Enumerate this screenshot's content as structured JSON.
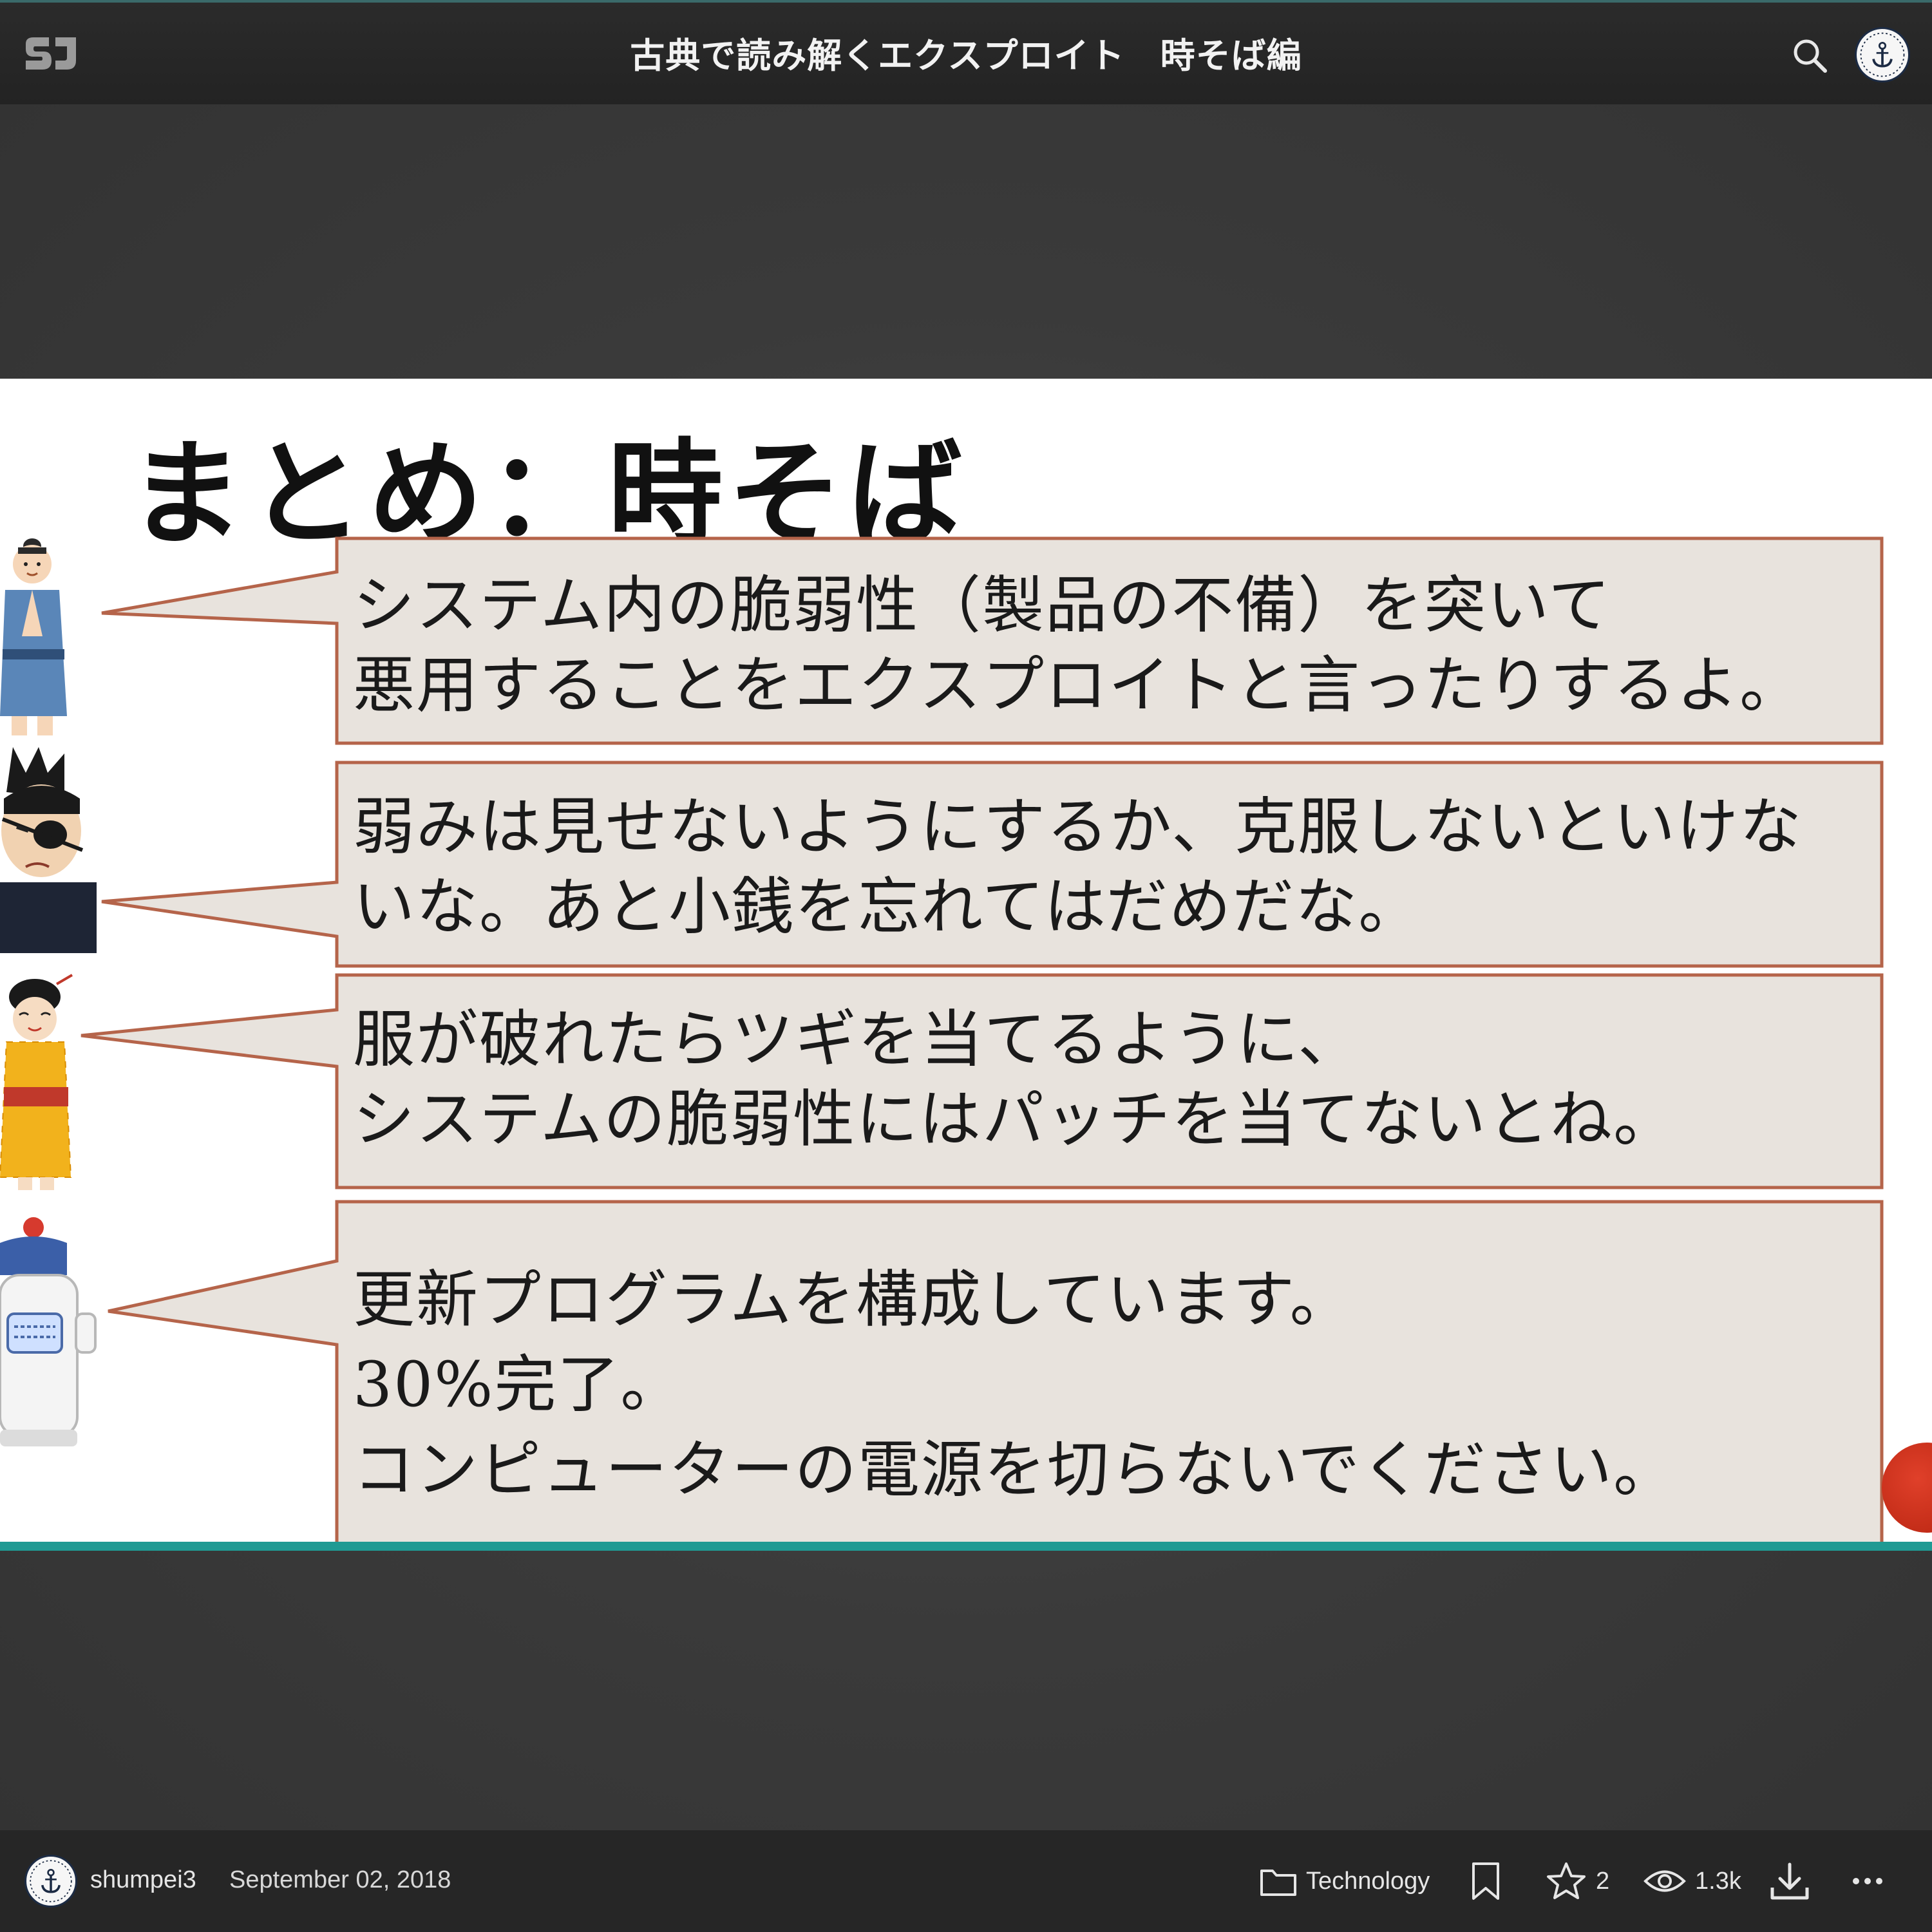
{
  "header": {
    "logo_text": "SJ",
    "title": "古典で読み解くエクスプロイト　時そば編"
  },
  "slide": {
    "heading": "まとめ：時そば",
    "bubbles": [
      {
        "speaker": "samurai-townsman",
        "lines": [
          "システム内の脆弱性（製品の不備）を突いて",
          "悪用することをエクスプロイトと言ったりするよ。"
        ]
      },
      {
        "speaker": "eyepatch-samurai",
        "lines": [
          "弱みは見せないようにするか、克服しないといけな",
          "いな。あと小銭を忘れてはだめだな。"
        ]
      },
      {
        "speaker": "edo-woman",
        "lines": [
          "服が破れたらツギを当てるように、",
          "システムの脆弱性にはパッチを当てないとね。"
        ]
      },
      {
        "speaker": "robot",
        "lines": [
          "更新プログラムを構成しています。",
          "30%完了。",
          "コンピューターの電源を切らないでください。"
        ]
      }
    ],
    "colors": {
      "bubble_fill": "#e8e3dd",
      "bubble_border": "#b5644a",
      "bottom_rule": "#1f9a93"
    }
  },
  "footer": {
    "author": "shumpei3",
    "date": "September 02, 2018",
    "category": "Technology",
    "stars": "2",
    "views": "1.3k",
    "icons": [
      "folder-icon",
      "bookmark-icon",
      "star-icon",
      "eye-icon",
      "download-icon",
      "more-icon"
    ]
  }
}
